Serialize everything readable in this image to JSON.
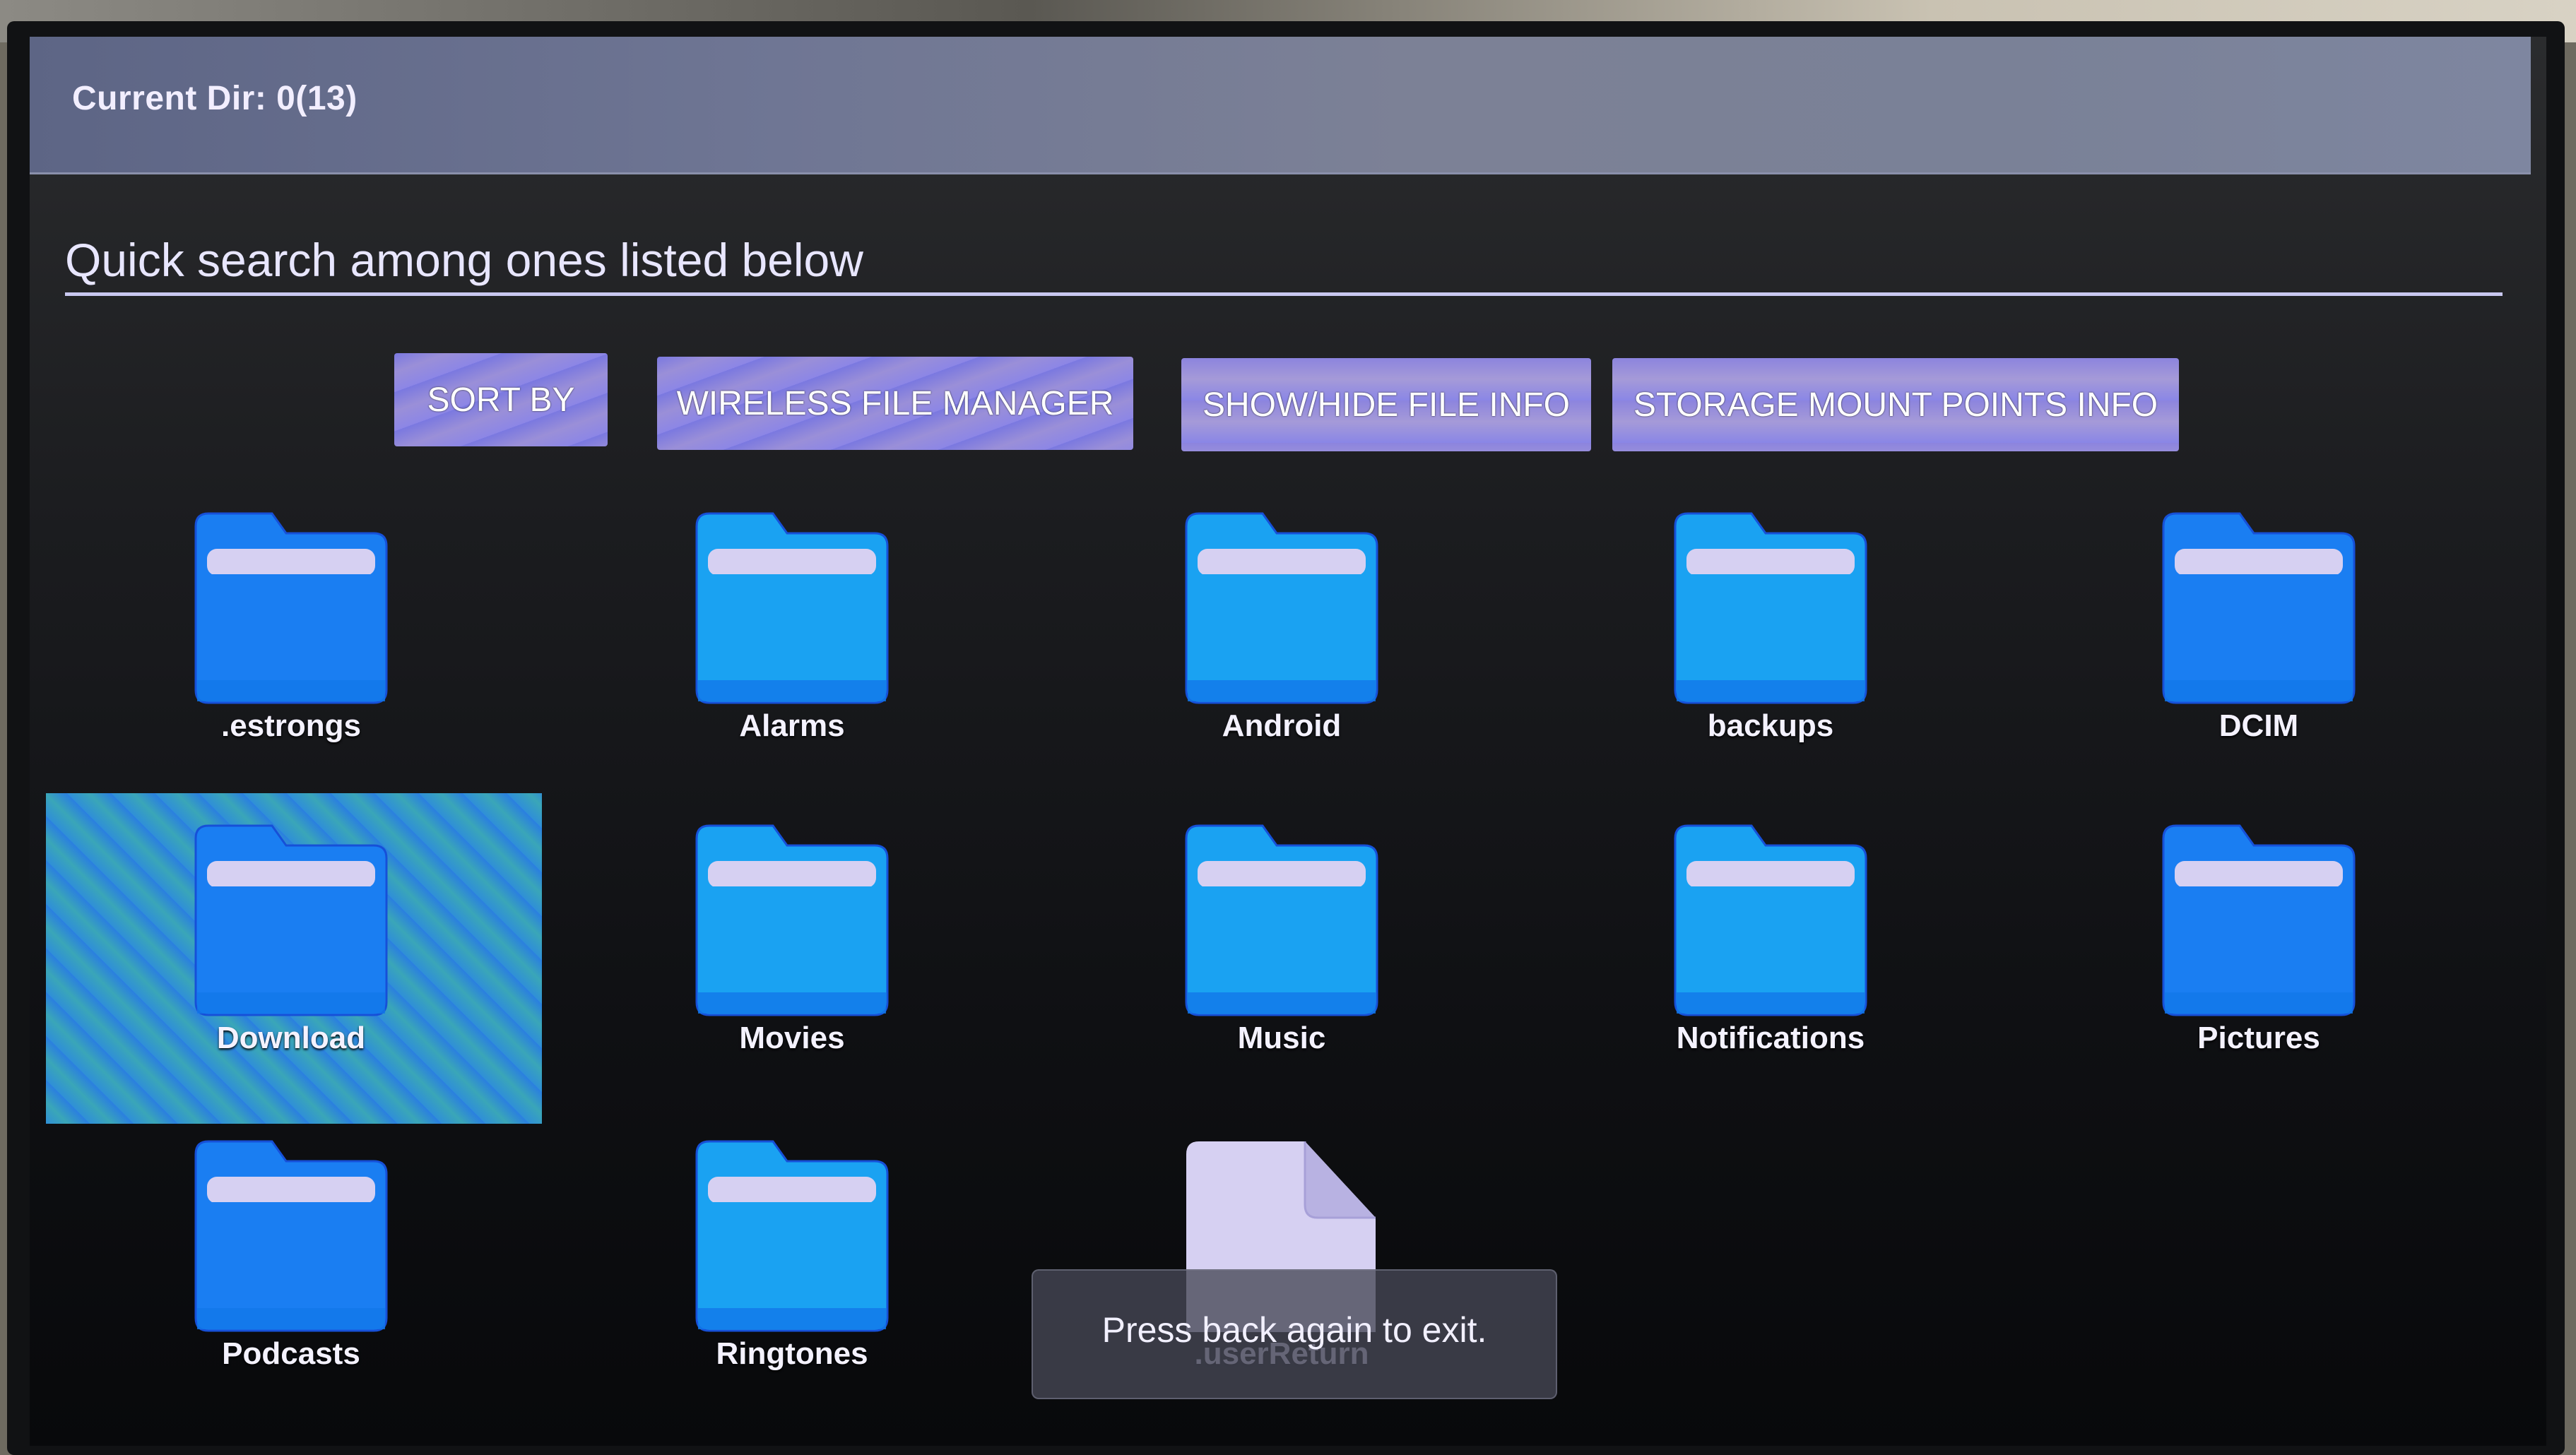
{
  "header": {
    "current_dir_label": "Current Dir: 0(13)"
  },
  "search": {
    "placeholder": "Quick search among ones listed below"
  },
  "toolbar": {
    "sort_by_label": "SORT BY",
    "wireless_label": "WIRELESS FILE MANAGER",
    "show_hide_label": "SHOW/HIDE FILE INFO",
    "storage_label": "STORAGE MOUNT POINTS INFO"
  },
  "items": [
    {
      "name": ".estrongs",
      "type": "folder",
      "selected": false
    },
    {
      "name": "Alarms",
      "type": "folder",
      "selected": false
    },
    {
      "name": "Android",
      "type": "folder",
      "selected": false
    },
    {
      "name": "backups",
      "type": "folder",
      "selected": false
    },
    {
      "name": "DCIM",
      "type": "folder",
      "selected": false
    },
    {
      "name": "Download",
      "type": "folder",
      "selected": true
    },
    {
      "name": "Movies",
      "type": "folder",
      "selected": false
    },
    {
      "name": "Music",
      "type": "folder",
      "selected": false
    },
    {
      "name": "Notifications",
      "type": "folder",
      "selected": false
    },
    {
      "name": "Pictures",
      "type": "folder",
      "selected": false
    },
    {
      "name": "Podcasts",
      "type": "folder",
      "selected": false
    },
    {
      "name": "Ringtones",
      "type": "folder",
      "selected": false
    },
    {
      "name": ".userReturn",
      "type": "file",
      "selected": false
    }
  ],
  "toast": {
    "message": "Press back again to exit."
  },
  "colors": {
    "folder_blue": "#1a9cf5",
    "folder_tab_light": "#d6d0f2",
    "selection_highlight": "#2f8fd8",
    "button_bg": "#8a86e6"
  }
}
